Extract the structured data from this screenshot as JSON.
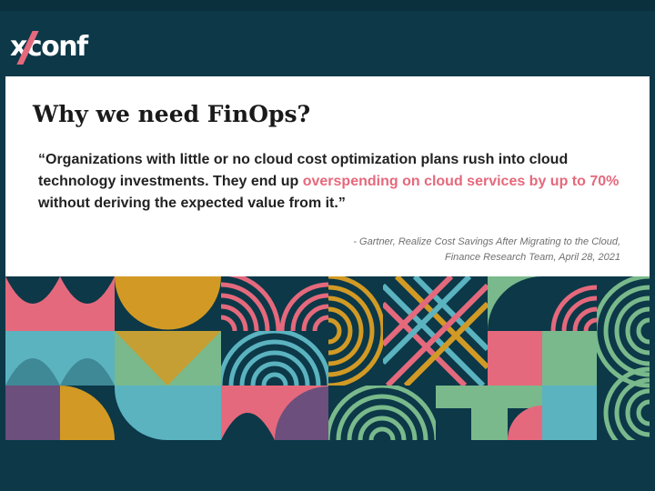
{
  "logo": {
    "text": "xconf"
  },
  "slide": {
    "title": "Why we need FinOps?",
    "quote_part1": "“Organizations with little or no cloud cost optimization plans rush into cloud technology investments. They end  up ",
    "quote_highlight": "overspending on cloud services by up to 70%",
    "quote_part2": "  without deriving the expected value from it.”",
    "attribution_line1": "- Gartner, Realize Cost Savings After Migrating to the Cloud,",
    "attribution_line2": "Finance Research Team, April 28, 2021"
  },
  "colors": {
    "background": "#0c3848",
    "pink": "#e5697c",
    "teal": "#5bb3c0",
    "green": "#79b98b",
    "mustard": "#d29a24",
    "purple": "#6c4f7c"
  }
}
